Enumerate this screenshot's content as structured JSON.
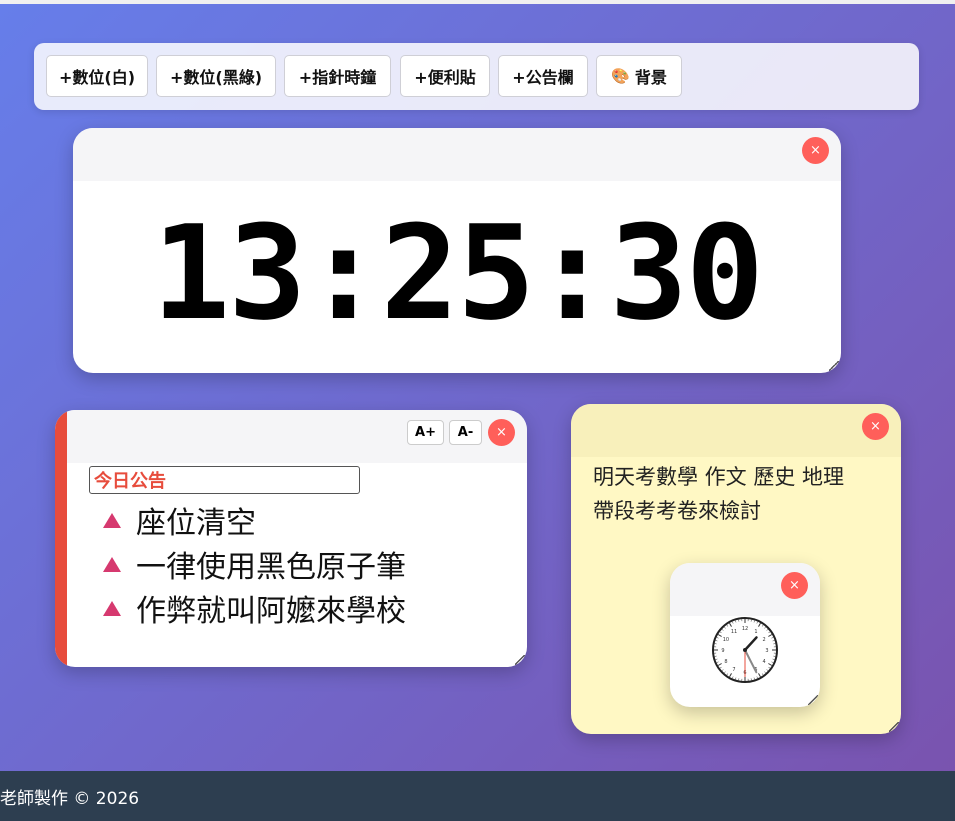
{
  "toolbar": {
    "buttons": [
      {
        "label": "+數位(白)"
      },
      {
        "label": "+數位(黑綠)"
      },
      {
        "label": "+指針時鐘"
      },
      {
        "label": "+便利貼"
      },
      {
        "label": "+公告欄"
      },
      {
        "label": "背景",
        "icon": "palette-icon"
      }
    ]
  },
  "digital_clock": {
    "time": "13:25:30",
    "close": "×"
  },
  "board": {
    "title_value": "今日公告",
    "font_up": "A+",
    "font_down": "A-",
    "close": "×",
    "accent": "#e74c3c",
    "bullet_color": "#d6396f",
    "items": [
      "座位清空",
      "一律使用黑色原子筆",
      "作弊就叫阿嬤來學校"
    ]
  },
  "sticky": {
    "text_line1": "明天考數學 作文 歷史 地理",
    "text_line2": "帶段考考卷來檢討",
    "close": "×",
    "color": "#fff8c4"
  },
  "analog_clock": {
    "close": "×",
    "hour": 13,
    "minute": 25,
    "second": 30,
    "numerals": [
      "12",
      "1",
      "2",
      "3",
      "4",
      "5",
      "6",
      "7",
      "8",
      "9",
      "10",
      "11"
    ]
  },
  "footer": {
    "text": "老師製作 © 2026"
  }
}
